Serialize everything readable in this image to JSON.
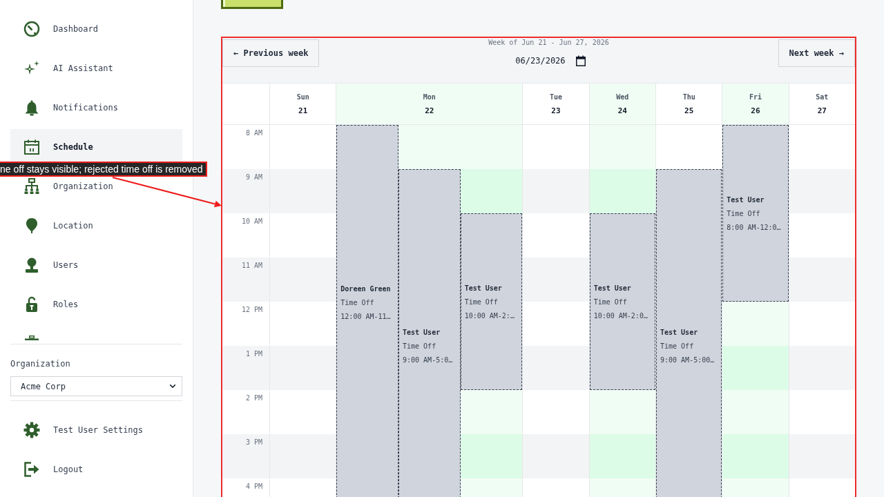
{
  "sidebar": {
    "items": [
      {
        "label": "Dashboard",
        "selected": false
      },
      {
        "label": "AI Assistant",
        "selected": false
      },
      {
        "label": "Notifications",
        "selected": false
      },
      {
        "label": "Schedule",
        "selected": true
      },
      {
        "label": "Organization",
        "selected": false
      },
      {
        "label": "Location",
        "selected": false
      },
      {
        "label": "Users",
        "selected": false
      },
      {
        "label": "Roles",
        "selected": false
      },
      {
        "selected": false
      }
    ],
    "organization_label": "Organization",
    "organization_select": {
      "value": "Acme Corp"
    },
    "footer_items": [
      {
        "label": "Test User Settings"
      },
      {
        "label": "Logout"
      }
    ]
  },
  "calendar": {
    "previous_button": "← Previous week",
    "week_label": "Week of Jun 21 - Jun 27, 2026",
    "date_field": {
      "value": "06/23/2026"
    },
    "next_button": "Next week →",
    "days": [
      {
        "name": "Sun",
        "date": "21",
        "highlighted": false
      },
      {
        "name": "Mon",
        "date": "22",
        "highlighted": true,
        "events": [
          {
            "name": "Doreen Green",
            "type": "Time Off",
            "time": "12:00 AM-11…"
          },
          {
            "name": "Test User",
            "type": "Time Off",
            "time": "9:00 AM-5:0…"
          },
          {
            "name": "Test User",
            "type": "Time Off",
            "time": "10:00 AM-2:…"
          }
        ]
      },
      {
        "name": "Tue",
        "date": "23",
        "highlighted": false
      },
      {
        "name": "Wed",
        "date": "24",
        "highlighted": true,
        "events": [
          {
            "name": "Test User",
            "type": "Time Off",
            "time": "10:00 AM-2:0…"
          }
        ]
      },
      {
        "name": "Thu",
        "date": "25",
        "highlighted": false,
        "events": [
          {
            "name": "Test User",
            "type": "Time Off",
            "time": "9:00 AM-5:00…"
          }
        ]
      },
      {
        "name": "Fri",
        "date": "26",
        "highlighted": true,
        "events": [
          {
            "name": "Test User",
            "type": "Time Off",
            "time": "8:00 AM-12:0…"
          }
        ]
      },
      {
        "name": "Sat",
        "date": "27",
        "highlighted": false
      }
    ],
    "time_labels": [
      "8 AM",
      "9 AM",
      "10 AM",
      "11 AM",
      "12 PM",
      "1 PM",
      "2 PM",
      "3 PM",
      "4 PM"
    ]
  },
  "annotation": {
    "text": "ne off stays visible; rejected time off is removed"
  }
}
